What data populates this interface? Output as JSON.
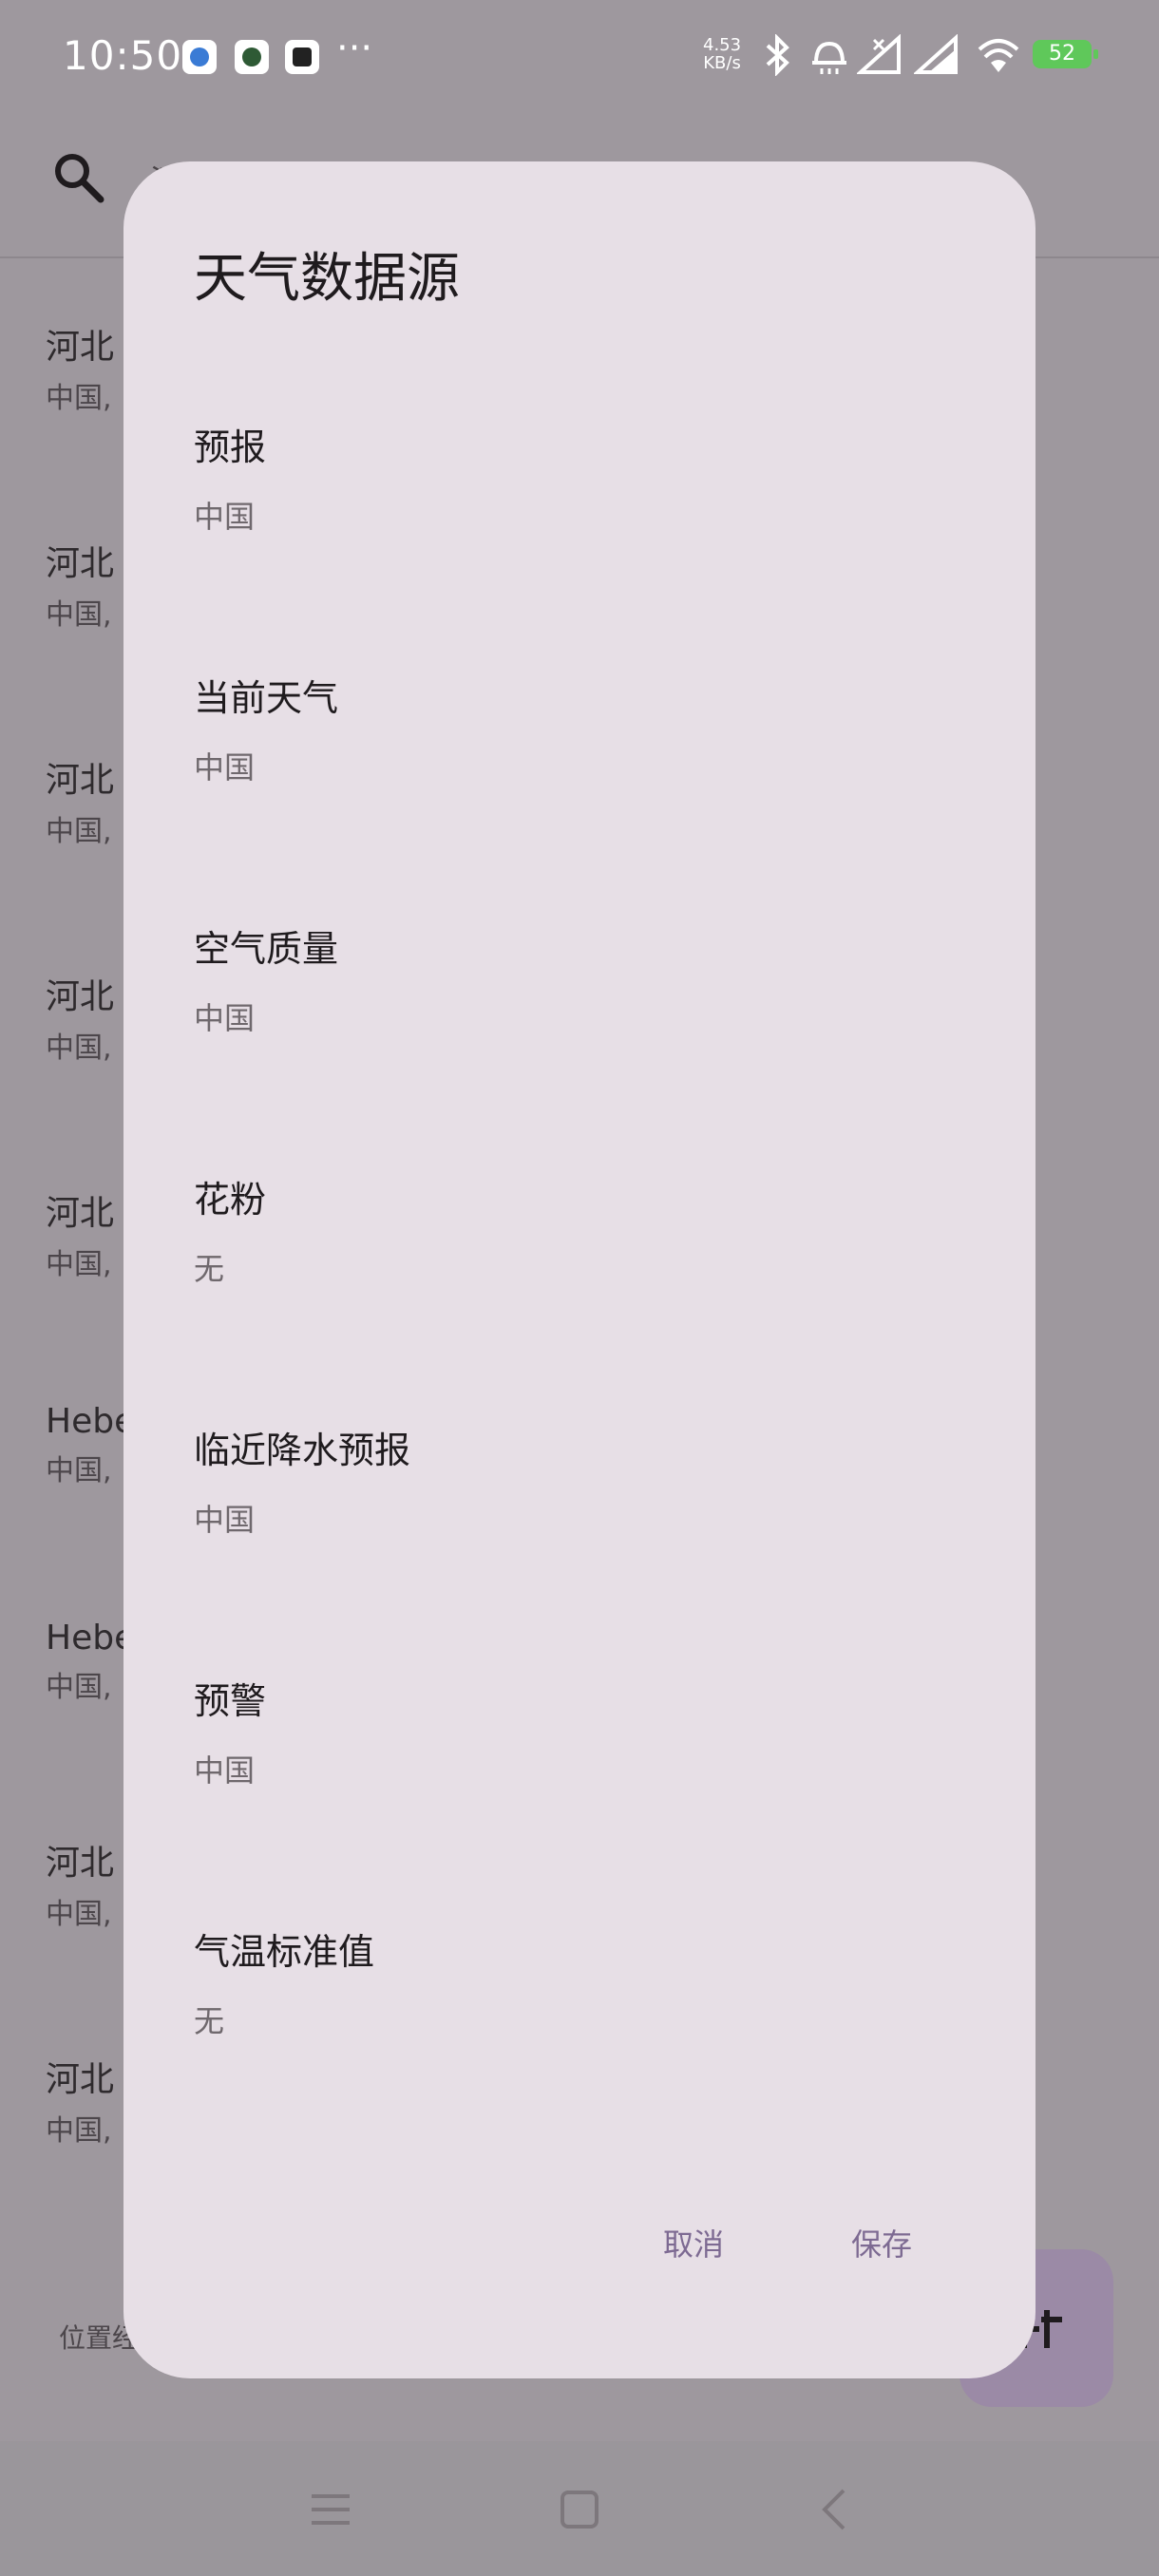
{
  "status_bar": {
    "time": "10:50",
    "speed_value": "4.53",
    "speed_unit": "KB/s",
    "battery": "52",
    "icons": [
      "bluetooth-icon",
      "alarm-icon",
      "signal-1-icon",
      "signal-2-icon",
      "wifi-icon"
    ]
  },
  "background": {
    "search_text": "河",
    "items": [
      {
        "title": "河北",
        "subtitle": "中国,"
      },
      {
        "title": "河北",
        "subtitle": "中国,"
      },
      {
        "title": "河北",
        "subtitle": "中国,"
      },
      {
        "title": "河北",
        "subtitle": "中国,"
      },
      {
        "title": "河北",
        "subtitle": "中国,"
      },
      {
        "title": "Hebe",
        "subtitle": "中国,"
      },
      {
        "title": "Hebe",
        "subtitle": "中国,"
      },
      {
        "title": "河北",
        "subtitle": "中国,"
      },
      {
        "title": "河北",
        "subtitle": "中国,"
      }
    ],
    "footer": "位置经"
  },
  "dialog": {
    "title": "天气数据源",
    "options": [
      {
        "label": "预报",
        "value": "中国"
      },
      {
        "label": "当前天气",
        "value": "中国"
      },
      {
        "label": "空气质量",
        "value": "中国"
      },
      {
        "label": "花粉",
        "value": "无"
      },
      {
        "label": "临近降水预报",
        "value": "中国"
      },
      {
        "label": "预警",
        "value": "中国"
      },
      {
        "label": "气温标准值",
        "value": "无"
      }
    ],
    "cancel_label": "取消",
    "save_label": "保存"
  },
  "colors": {
    "dialog_bg": "#e7dfe6",
    "accent": "#7d6a92",
    "scrim": "#9e989e"
  }
}
